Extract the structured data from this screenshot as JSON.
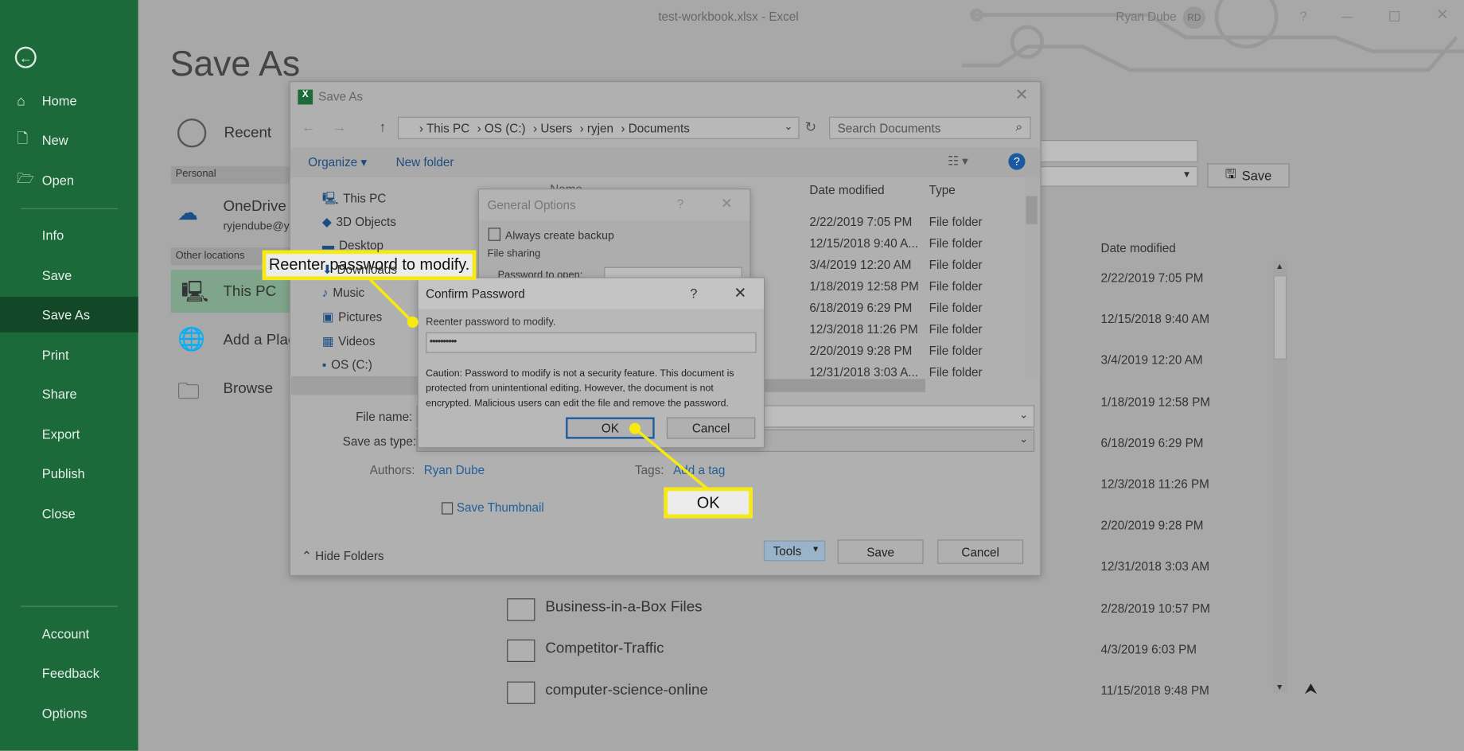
{
  "window": {
    "title": "test-workbook.xlsx  -  Excel",
    "user_name": "Ryan Dube",
    "user_initials": "RD",
    "help": "?"
  },
  "sidebar": {
    "items": [
      {
        "label": "Home",
        "icon": "home-icon"
      },
      {
        "label": "New",
        "icon": "new-icon"
      },
      {
        "label": "Open",
        "icon": "open-icon"
      },
      {
        "label": "Info"
      },
      {
        "label": "Save"
      },
      {
        "label": "Save As",
        "selected": true
      },
      {
        "label": "Print"
      },
      {
        "label": "Share"
      },
      {
        "label": "Export"
      },
      {
        "label": "Publish"
      },
      {
        "label": "Close"
      },
      {
        "label": "Account"
      },
      {
        "label": "Feedback"
      },
      {
        "label": "Options"
      }
    ]
  },
  "backstage": {
    "title": "Save As",
    "recent": "Recent",
    "personal": "Personal",
    "onedrive": "OneDrive -",
    "onedrive_email": "ryjendube@y",
    "other_locations": "Other locations",
    "this_pc": "This PC",
    "add_place": "Add a Plac",
    "browse": "Browse",
    "save_button": "Save",
    "date_modified_header": "Date modified",
    "dates": [
      "2/22/2019 7:05 PM",
      "12/15/2018 9:40 AM",
      "3/4/2019 12:20 AM",
      "1/18/2019 12:58 PM",
      "6/18/2019 6:29 PM",
      "12/3/2018 11:26 PM",
      "2/20/2019 9:28 PM",
      "12/31/2018 3:03 AM",
      "2/28/2019 10:57 PM",
      "4/3/2019 6:03 PM",
      "11/15/2018 9:48 PM"
    ],
    "folders": [
      "Business-in-a-Box Files",
      "Competitor-Traffic",
      "computer-science-online"
    ]
  },
  "saveas_dialog": {
    "title": "Save As",
    "breadcrumb": [
      "This PC",
      "OS (C:)",
      "Users",
      "ryjen",
      "Documents"
    ],
    "search_placeholder": "Search Documents",
    "organize": "Organize ▾",
    "new_folder": "New folder",
    "nav_items": [
      "This PC",
      "3D Objects",
      "Desktop",
      "Downloads",
      "Music",
      "Pictures",
      "Videos",
      "OS (C:)"
    ],
    "col_name": "Name",
    "col_date": "Date modified",
    "col_type": "Type",
    "rows": [
      {
        "date": "2/22/2019 7:05 PM",
        "type": "File folder"
      },
      {
        "date": "12/15/2018 9:40 A...",
        "type": "File folder"
      },
      {
        "date": "3/4/2019 12:20 AM",
        "type": "File folder"
      },
      {
        "date": "1/18/2019 12:58 PM",
        "type": "File folder"
      },
      {
        "date": "6/18/2019 6:29 PM",
        "type": "File folder"
      },
      {
        "date": "12/3/2018 11:26 PM",
        "type": "File folder"
      },
      {
        "date": "2/20/2019 9:28 PM",
        "type": "File folder"
      },
      {
        "date": "12/31/2018 3:03 A...",
        "type": "File folder"
      }
    ],
    "file_name_label": "File name:",
    "save_as_type_label": "Save as type:",
    "authors_label": "Authors:",
    "authors_value": "Ryan Dube",
    "tags_label": "Tags:",
    "tags_value": "Add a tag",
    "save_thumbnail": "Save Thumbnail",
    "hide_folders": "Hide Folders",
    "tools": "Tools",
    "save": "Save",
    "cancel": "Cancel"
  },
  "general_options": {
    "title": "General Options",
    "help": "?",
    "always_backup": "Always create backup",
    "file_sharing": "File sharing",
    "password_to_open": "Password to open:"
  },
  "confirm_password": {
    "title": "Confirm Password",
    "help": "?",
    "label": "Reenter password to modify.",
    "value": "••••••••••",
    "caution": "Caution: Password to modify is not a security feature. This document is protected from unintentional editing. However, the document is not encrypted. Malicious users can edit the file and remove the password.",
    "ok": "OK",
    "cancel": "Cancel"
  },
  "callouts": {
    "label": "Reenter password to modify.",
    "ok": "OK"
  },
  "colors": {
    "sidebar": "#1c6a3a",
    "sidebar_selected": "#124727",
    "callout": "#f7ea10",
    "link": "#1f5f99",
    "ok_border": "#1a5aa0"
  }
}
